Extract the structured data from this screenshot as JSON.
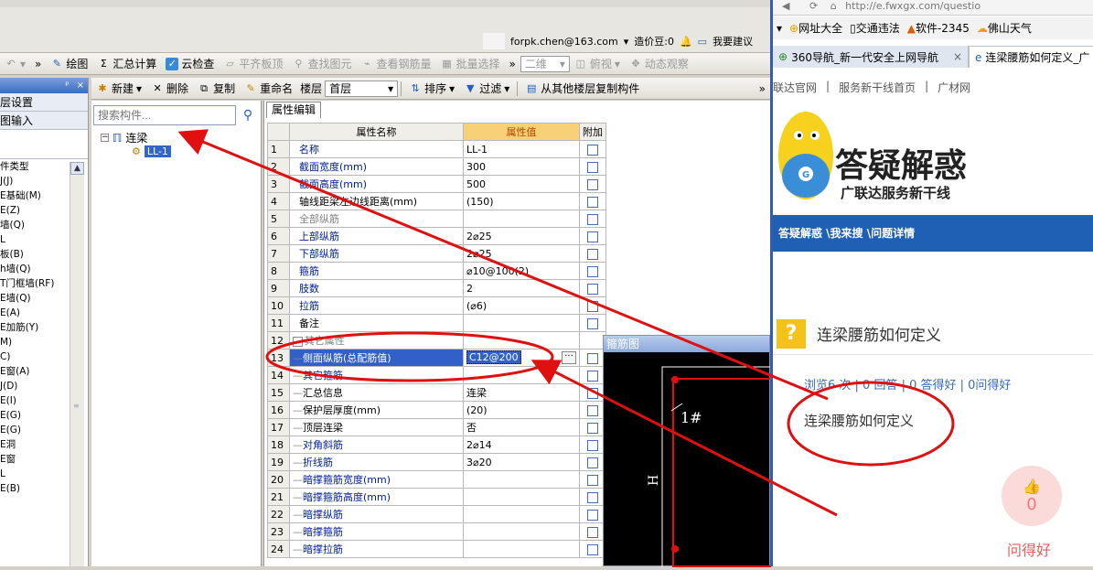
{
  "app": {
    "account_email": "forpk.chen@163.com",
    "price_label": "造价豆:0",
    "suggest_label": "我要建议"
  },
  "toolbar1": {
    "undo_icon": "undo-icon",
    "overflow1": "»",
    "draw": "绘图",
    "sum_calc": "汇总计算",
    "cloud_check": "云检查",
    "flush_slab": "平齐板顶",
    "find_element": "查找图元",
    "view_rebar": "查看钢筋量",
    "batch_select": "批量选择",
    "overflow2": "»",
    "view_mode": "二维",
    "top_view": "俯视",
    "dynamic_view": "动态观察"
  },
  "left_panel": {
    "header_pin": "ᵖ",
    "header_close": "×",
    "row1": "层设置",
    "row2": "图输入",
    "items": [
      "件类型",
      "J(J)",
      "E基础(M)",
      "E(Z)",
      "墙(Q)",
      "L",
      "板(B)",
      "",
      "",
      "",
      "",
      "h墙(Q)",
      "T门框墙(RF)",
      "E墙(Q)",
      "E(A)",
      "E加筋(Y)",
      "",
      "M)",
      "C)",
      "E窗(A)",
      "J(D)",
      "E(I)",
      "E(G)",
      "E(G)",
      "E洞",
      "E窗",
      "",
      "L",
      "E(B)"
    ]
  },
  "toolbar2": {
    "new": "新建",
    "delete": "删除",
    "copy": "复制",
    "rename": "重命名",
    "floor_label": "楼层",
    "floor_value": "首层",
    "sort": "排序",
    "filter": "过滤",
    "copy_from_floor": "从其他楼层复制构件",
    "overflow": "»"
  },
  "tree": {
    "search_placeholder": "搜索构件...",
    "root": "连梁",
    "child": "LL-1"
  },
  "props": {
    "tab": "属性编辑",
    "col_name": "属性名称",
    "col_value": "属性值",
    "col_extra": "附加",
    "rows": [
      {
        "n": "1",
        "name": "名称",
        "value": "LL-1"
      },
      {
        "n": "2",
        "name": "截面宽度(mm)",
        "value": "300"
      },
      {
        "n": "3",
        "name": "截面高度(mm)",
        "value": "500"
      },
      {
        "n": "4",
        "name": "轴线距梁左边线距离(mm)",
        "value": "(150)"
      },
      {
        "n": "5",
        "name": "全部纵筋",
        "value": ""
      },
      {
        "n": "6",
        "name": "上部纵筋",
        "value": "2⌀25"
      },
      {
        "n": "7",
        "name": "下部纵筋",
        "value": "2⌀25"
      },
      {
        "n": "8",
        "name": "箍筋",
        "value": "⌀10@100(2)"
      },
      {
        "n": "9",
        "name": "肢数",
        "value": "2"
      },
      {
        "n": "10",
        "name": "拉筋",
        "value": "(⌀6)"
      },
      {
        "n": "11",
        "name": "备注",
        "value": ""
      },
      {
        "n": "12",
        "name": "其它属性",
        "value": ""
      },
      {
        "n": "13",
        "name": "侧面纵筋(总配筋值)",
        "value": "C12@200"
      },
      {
        "n": "14",
        "name": "其它箍筋",
        "value": ""
      },
      {
        "n": "15",
        "name": "汇总信息",
        "value": "连梁"
      },
      {
        "n": "16",
        "name": "保护层厚度(mm)",
        "value": "(20)"
      },
      {
        "n": "17",
        "name": "顶层连梁",
        "value": "否"
      },
      {
        "n": "18",
        "name": "对角斜筋",
        "value": "2⌀14"
      },
      {
        "n": "19",
        "name": "折线筋",
        "value": "3⌀20"
      },
      {
        "n": "20",
        "name": "暗撑箍筋宽度(mm)",
        "value": ""
      },
      {
        "n": "21",
        "name": "暗撑箍筋高度(mm)",
        "value": ""
      },
      {
        "n": "22",
        "name": "暗撑纵筋",
        "value": ""
      },
      {
        "n": "23",
        "name": "暗撑箍筋",
        "value": ""
      },
      {
        "n": "24",
        "name": "暗撑拉筋",
        "value": ""
      }
    ]
  },
  "hoop": {
    "title": "箍筋图",
    "label_1": "1#",
    "label_h": "H"
  },
  "browser": {
    "url": "http://e.fwxgx.com/questio",
    "fav1": "网址大全",
    "fav2": "交通违法",
    "fav3": "软件-2345",
    "fav4": "佛山天气",
    "tab1": "360导航_新一代安全上网导航",
    "tab1_close": "×",
    "tab2": "连梁腰筋如何定义_广",
    "sub1": "联达官网",
    "sub2": "服务新干线首页",
    "sub3": "广材网",
    "banner_title": "答疑解惑",
    "banner_sub": "广联达服务新干线",
    "mascot_letter": "G",
    "breadcrumb": "答疑解惑 \\我来搜 \\问题详情",
    "q_title": "连梁腰筋如何定义",
    "q_icon": "?",
    "stats": "浏览6 次 | 0 回答 | 0 答得好 | 0问得好",
    "q_body": "连梁腰筋如何定义",
    "like_count": "0",
    "like_label": "问得好",
    "like_icon": "👍"
  },
  "colors": {
    "annotation": "#e01010",
    "selection": "#3060c8",
    "header_value_bg": "#f8d078",
    "brand_blue": "#1f5fb4"
  }
}
